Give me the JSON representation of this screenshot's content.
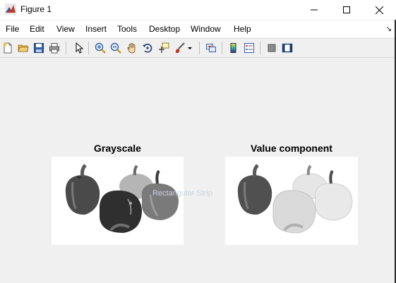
{
  "window": {
    "title": "Figure 1"
  },
  "menu": [
    "File",
    "Edit",
    "View",
    "Insert",
    "Tools",
    "Desktop",
    "Window",
    "Help"
  ],
  "toolbar": {
    "icons": [
      "new-figure-icon",
      "open-file-icon",
      "save-icon",
      "print-icon",
      "pointer-icon",
      "zoom-in-icon",
      "zoom-out-icon",
      "pan-icon",
      "rotate-3d-icon",
      "data-cursor-icon",
      "brush-icon",
      "brush-dropdown-icon",
      "link-plot-icon",
      "colorbar-icon",
      "legend-icon",
      "hide-plot-tools-icon",
      "show-plot-tools-icon"
    ]
  },
  "axes": [
    {
      "title": "Grayscale"
    },
    {
      "title": "Value component"
    }
  ],
  "overlay": {
    "tooltip": "Rectangular Strip"
  },
  "colors": {
    "background": "#f0f0f0",
    "window": "#ffffff"
  }
}
